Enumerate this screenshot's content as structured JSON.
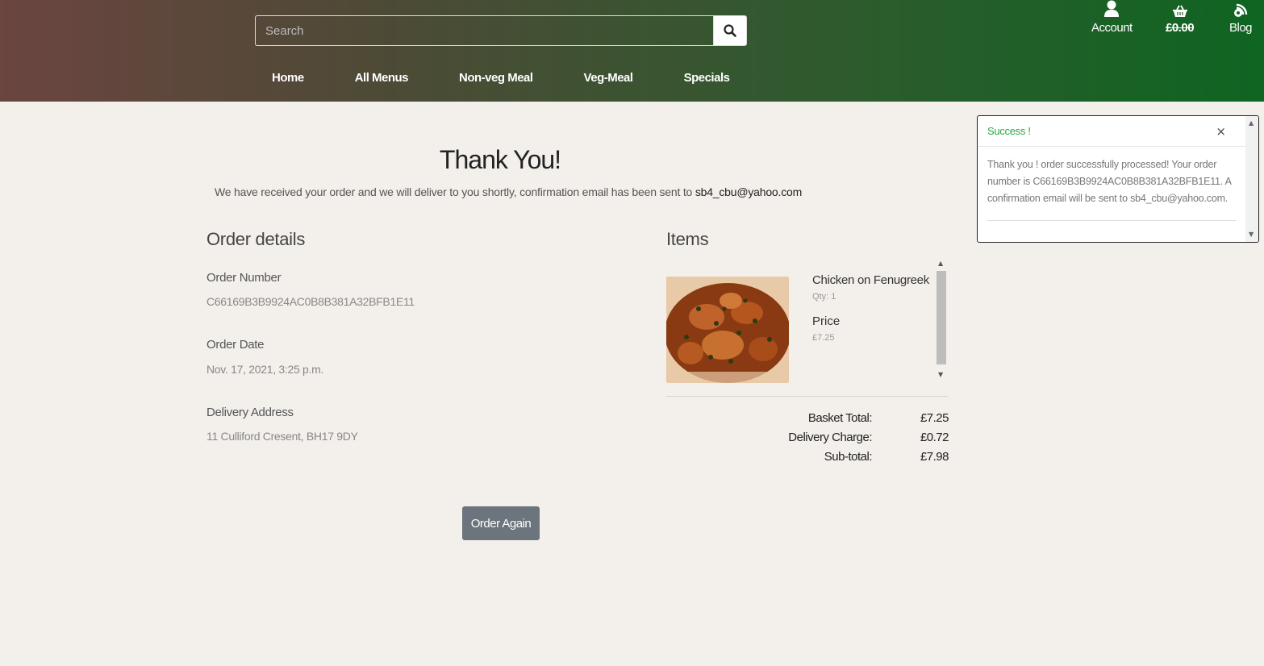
{
  "header": {
    "search_placeholder": "Search",
    "nav": [
      "Home",
      "All Menus",
      "Non-veg Meal",
      "Veg-Meal",
      "Specials"
    ],
    "account_label": "Account",
    "basket_total": "£0.00",
    "blog_label": "Blog"
  },
  "main": {
    "title": "Thank You!",
    "subtitle": "We have received your order and we will deliver to you shortly, confirmation email has been sent to",
    "email": "sb4_cbu@yahoo.com",
    "order_details_heading": "Order details",
    "order_number_label": "Order Number",
    "order_number": "C66169B3B9924AC0B8B381A32BFB1E11",
    "order_date_label": "Order Date",
    "order_date": "Nov. 17, 2021, 3:25 p.m.",
    "delivery_address_label": "Delivery Address",
    "delivery_address": "11 Culliford Cresent, BH17 9DY",
    "items_heading": "Items",
    "item": {
      "name": "Chicken on Fenugreek",
      "qty": "Qty: 1",
      "price_label": "Price",
      "price": "£7.25"
    },
    "totals": [
      {
        "label": "Basket Total:",
        "value": "£7.25"
      },
      {
        "label": "Delivery Charge:",
        "value": "£0.72"
      },
      {
        "label": "Sub-total:",
        "value": "£7.98"
      }
    ],
    "order_again_label": "Order Again"
  },
  "toast": {
    "title": "Success !",
    "close": "×",
    "message": "Thank you ! order successfully processed! Your order number is C66169B3B9924AC0B8B381A32BFB1E11. A confirmation email will be sent to sb4_cbu@yahoo.com."
  },
  "colors": {
    "success": "#28a745",
    "button": "#6c757d",
    "background": "#f3f0eb"
  },
  "icons": [
    "search-icon",
    "user-icon",
    "basket-icon",
    "blog-icon",
    "close-icon"
  ]
}
